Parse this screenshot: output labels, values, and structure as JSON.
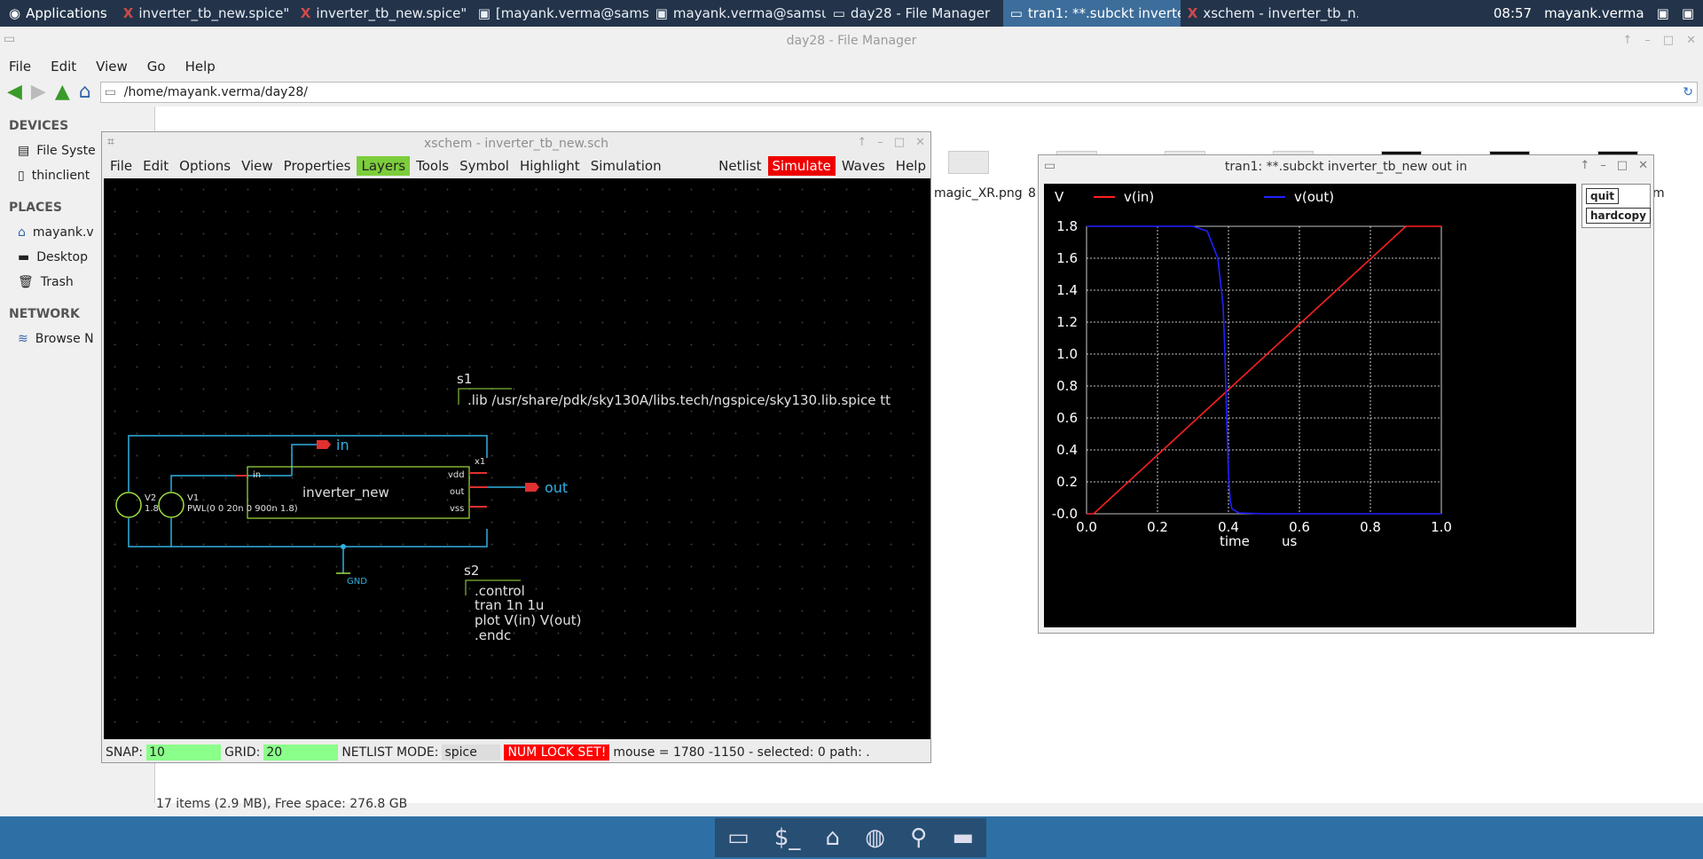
{
  "topbar": {
    "apps_label": "Applications",
    "tasks": [
      {
        "label": "inverter_tb_new.spice\" -..."
      },
      {
        "label": "inverter_tb_new.spice\" -..."
      },
      {
        "label": "[mayank.verma@sams..."
      },
      {
        "label": "mayank.verma@samsu..."
      },
      {
        "label": "day28 - File Manager"
      },
      {
        "label": "tran1: **.subckt inverte..."
      },
      {
        "label": "xschem - inverter_tb_n..."
      }
    ],
    "clock": "08:57",
    "user": "mayank.verma"
  },
  "file_manager": {
    "title": "day28 - File Manager",
    "menu": [
      "File",
      "Edit",
      "View",
      "Go",
      "Help"
    ],
    "path": "/home/mayank.verma/day28/",
    "sidebar": {
      "devices_header": "DEVICES",
      "devices": [
        "File Syste",
        "thinclient"
      ],
      "places_header": "PLACES",
      "places": [
        "mayank.v",
        "Desktop",
        "Trash"
      ],
      "network_header": "NETWORK",
      "network": [
        "Browse N"
      ]
    },
    "visible_file_label": "magic_XR.png",
    "partial_label_1": "8",
    "partial_label_2": "m",
    "status": "17 items (2.9 MB), Free space: 276.8 GB"
  },
  "xschem": {
    "title": "xschem - inverter_tb_new.sch",
    "menu": [
      "File",
      "Edit",
      "Options",
      "View",
      "Properties",
      "Layers",
      "Tools",
      "Symbol",
      "Highlight",
      "Simulation"
    ],
    "right_buttons": [
      "Netlist",
      "Simulate",
      "Waves",
      "Help"
    ],
    "schematic": {
      "s1_label": "s1",
      "s1_text": ".lib /usr/share/pdk/sky130A/libs.tech/ngspice/sky130.lib.spice tt",
      "pin_in": "in",
      "pin_out": "out",
      "block_name": "inverter_new",
      "block_inst": "x1",
      "port_in": "in",
      "port_vdd": "vdd",
      "port_out": "out",
      "port_vss": "vss",
      "v2_name": "V2",
      "v2_value": "1.8",
      "v1_name": "V1",
      "v1_value": "PWL(0 0 20n 0 900n 1.8)",
      "gnd_label": "GND",
      "s2_label": "s2",
      "s2_lines": [
        ".control",
        "tran 1n 1u",
        "plot V(in) V(out)",
        ".endc"
      ]
    },
    "status": {
      "snap_label": "SNAP:",
      "snap_value": "10",
      "grid_label": "GRID:",
      "grid_value": "20",
      "netlist_label": "NETLIST MODE:",
      "netlist_value": "spice",
      "numlock": "NUM LOCK SET!",
      "mouse": "mouse = 1780 -1150 - selected: 0 path: ."
    }
  },
  "plot_window": {
    "title": "tran1: **.subckt inverter_tb_new out in",
    "buttons": [
      "quit",
      "hardcopy"
    ]
  },
  "chart_data": {
    "type": "line",
    "y_unit_label": "V",
    "xlabel": "time",
    "x_unit": "us",
    "xlim": [
      0,
      1.0
    ],
    "ylim": [
      0,
      1.8
    ],
    "x_ticks": [
      "0.0",
      "0.2",
      "0.4",
      "0.6",
      "0.8",
      "1.0"
    ],
    "y_ticks": [
      "-0.0",
      "0.2",
      "0.4",
      "0.6",
      "0.8",
      "1.0",
      "1.2",
      "1.4",
      "1.6",
      "1.8"
    ],
    "grid": true,
    "colors": {
      "background": "#000000",
      "grid": "#ffffff",
      "vin": "#ff2020",
      "vout": "#2020ff"
    },
    "series": [
      {
        "name": "v(in)",
        "x": [
          0.0,
          0.02,
          0.9,
          1.0
        ],
        "y": [
          0.0,
          0.0,
          1.8,
          1.8
        ]
      },
      {
        "name": "v(out)",
        "x": [
          0.0,
          0.3,
          0.34,
          0.37,
          0.385,
          0.39,
          0.395,
          0.4,
          0.405,
          0.41,
          0.43,
          0.5,
          1.0
        ],
        "y": [
          1.8,
          1.8,
          1.77,
          1.6,
          1.3,
          1.0,
          0.6,
          0.25,
          0.08,
          0.03,
          0.005,
          0.0,
          0.0
        ]
      }
    ]
  },
  "colors": {
    "topbar": "#23344a",
    "active_task": "#3d6d9a",
    "dock": "#2e6fa5",
    "xschem_wire": "#30b0e0",
    "xschem_symbol": "#a0e040",
    "xschem_pin": "#e03030"
  }
}
